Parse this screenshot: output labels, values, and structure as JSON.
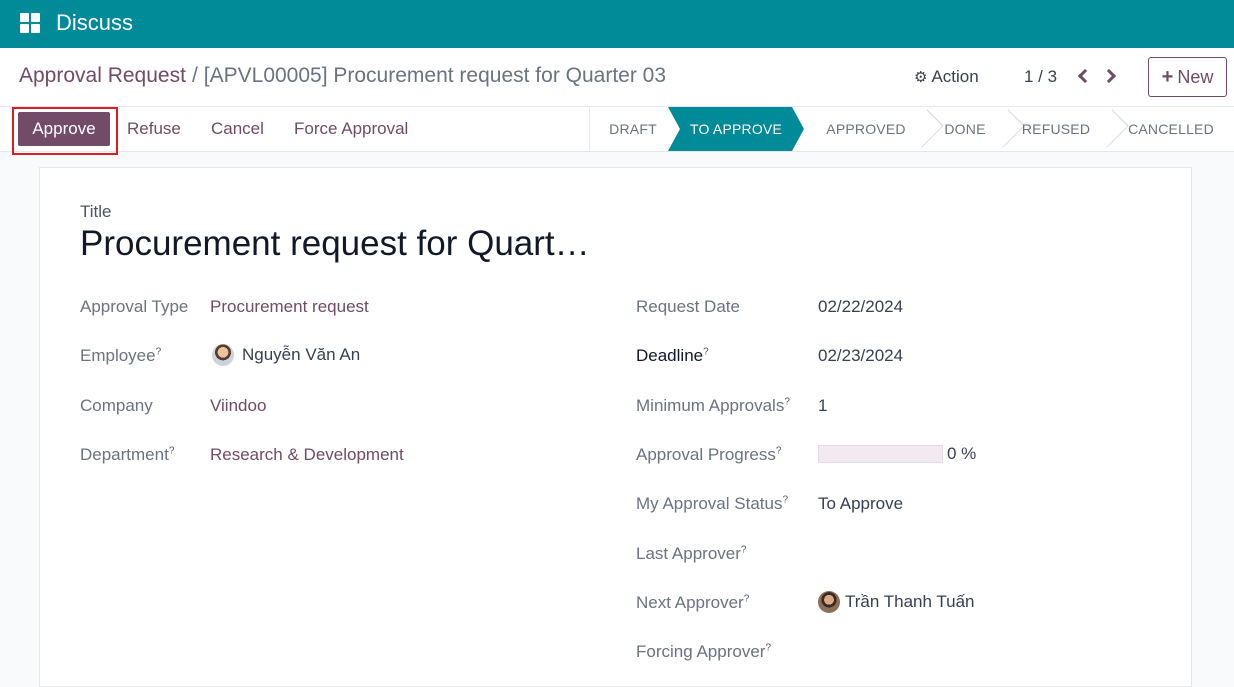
{
  "app": {
    "title": "Discuss",
    "icon": "apps-grid-icon"
  },
  "breadcrumb": {
    "parent": "Approval Request",
    "separator": "/",
    "current": "[APVL00005] Procurement request for Quarter 03"
  },
  "toolbar": {
    "action_label": "Action",
    "pager": "1 / 3",
    "new_label": "New"
  },
  "header_buttons": {
    "approve": "Approve",
    "refuse": "Refuse",
    "cancel": "Cancel",
    "force": "Force Approval"
  },
  "status_steps": [
    {
      "label": "DRAFT",
      "active": false
    },
    {
      "label": "TO APPROVE",
      "active": true
    },
    {
      "label": "APPROVED",
      "active": false
    },
    {
      "label": "DONE",
      "active": false
    },
    {
      "label": "REFUSED",
      "active": false
    },
    {
      "label": "CANCELLED",
      "active": false
    }
  ],
  "form": {
    "title_label": "Title",
    "title_value": "Procurement request for Quart…",
    "left": {
      "approval_type": {
        "label": "Approval Type",
        "value": "Procurement request"
      },
      "employee": {
        "label": "Employee",
        "help": "?",
        "value": "Nguyễn Văn An"
      },
      "company": {
        "label": "Company",
        "value": "Viindoo"
      },
      "department": {
        "label": "Department",
        "help": "?",
        "value": "Research & Development"
      }
    },
    "right": {
      "request_date": {
        "label": "Request Date",
        "value": "02/22/2024"
      },
      "deadline": {
        "label": "Deadline",
        "help": "?",
        "value": "02/23/2024"
      },
      "min_approvals": {
        "label": "Minimum Approvals",
        "help": "?",
        "value": "1"
      },
      "approval_progress": {
        "label": "Approval Progress",
        "help": "?",
        "value": "0 %",
        "fraction": 0
      },
      "my_status": {
        "label": "My Approval Status",
        "help": "?",
        "value": "To Approve"
      },
      "last_approver": {
        "label": "Last Approver",
        "help": "?"
      },
      "next_approver": {
        "label": "Next Approver",
        "help": "?",
        "value": "Trần Thanh Tuấn"
      },
      "forcing_approver": {
        "label": "Forcing Approver",
        "help": "?"
      }
    }
  },
  "colors": {
    "topbar": "#018a97",
    "brand": "#714b67",
    "highlight": "#e01b24"
  }
}
